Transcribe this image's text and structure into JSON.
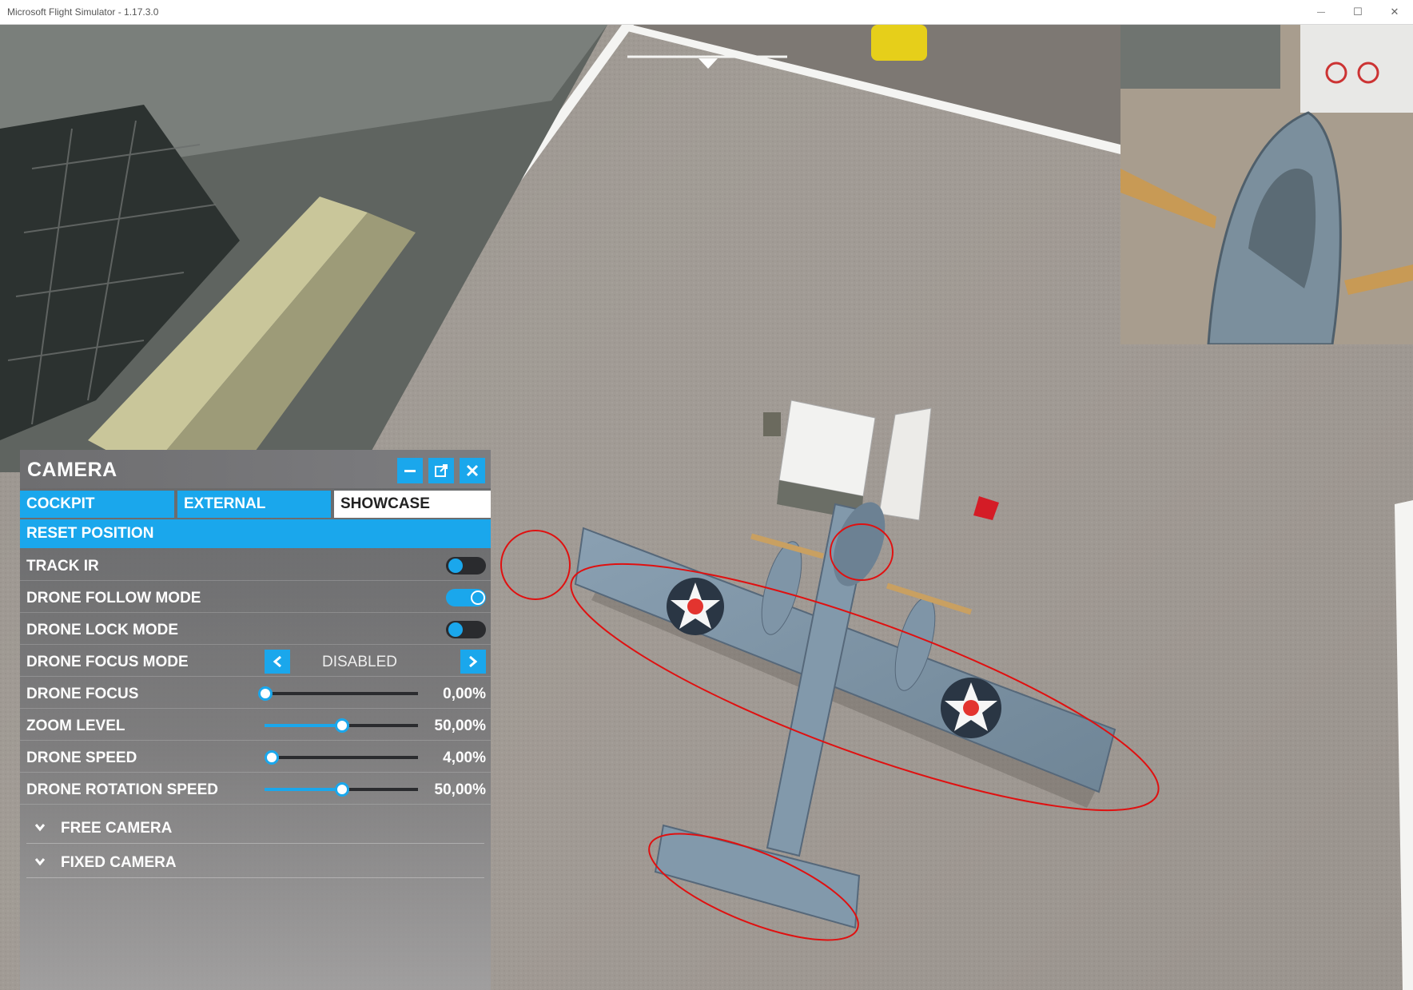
{
  "window": {
    "title": "Microsoft Flight Simulator - 1.17.3.0",
    "minimize_glyph": "—",
    "maximize_glyph": "☐",
    "close_glyph": "✕"
  },
  "panel": {
    "title": "CAMERA",
    "tabs": [
      {
        "label": "COCKPIT",
        "active": false
      },
      {
        "label": "EXTERNAL",
        "active": false
      },
      {
        "label": "SHOWCASE",
        "active": true
      }
    ],
    "reset_label": "RESET POSITION",
    "toggles": [
      {
        "label": "TRACK IR",
        "on": false
      },
      {
        "label": "DRONE FOLLOW MODE",
        "on": true
      },
      {
        "label": "DRONE LOCK MODE",
        "on": false
      }
    ],
    "focus_mode": {
      "label": "DRONE FOCUS MODE",
      "value": "DISABLED"
    },
    "sliders": [
      {
        "label": "DRONE FOCUS",
        "value_text": "0,00%",
        "value": 0.0
      },
      {
        "label": "ZOOM LEVEL",
        "value_text": "50,00%",
        "value": 0.5
      },
      {
        "label": "DRONE SPEED",
        "value_text": "4,00%",
        "value": 0.04
      },
      {
        "label": "DRONE ROTATION SPEED",
        "value_text": "50,00%",
        "value": 0.5
      }
    ],
    "sections": [
      {
        "label": "FREE CAMERA"
      },
      {
        "label": "FIXED CAMERA"
      }
    ]
  },
  "colors": {
    "accent": "#1aa7ec",
    "annotation": "#e01010",
    "tarmac": "#a29d96"
  }
}
